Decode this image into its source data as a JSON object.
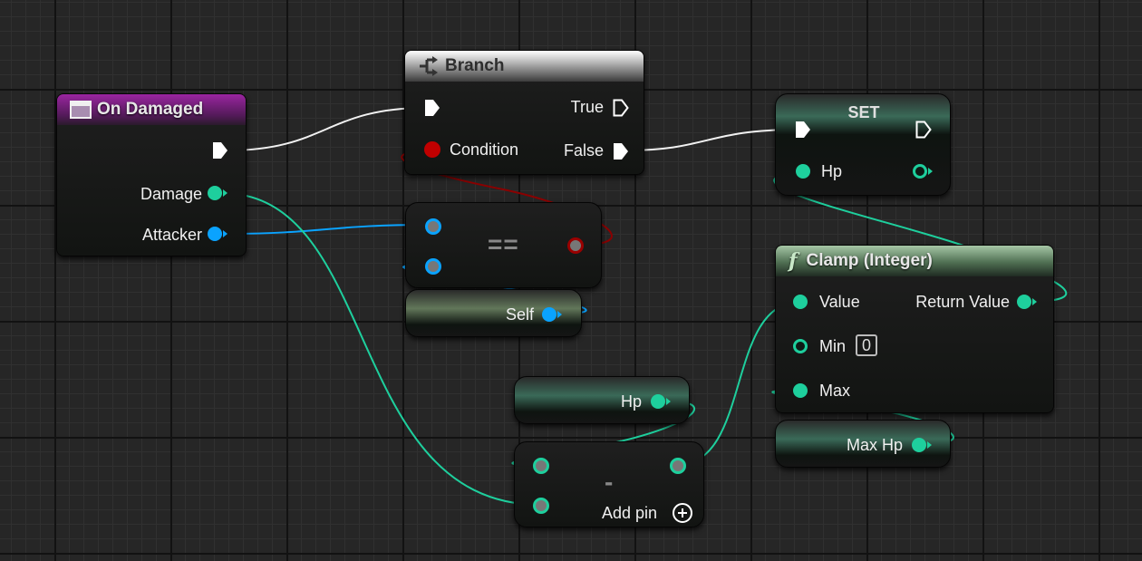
{
  "nodes": {
    "event": {
      "title": "On Damaged",
      "pins": {
        "damage": "Damage",
        "attacker": "Attacker"
      }
    },
    "branch": {
      "title": "Branch",
      "pins": {
        "condition": "Condition",
        "true": "True",
        "false": "False"
      }
    },
    "set": {
      "title": "SET",
      "pins": {
        "hp": "Hp"
      }
    },
    "equals": {
      "op": "=="
    },
    "self": {
      "label": "Self"
    },
    "clamp": {
      "title": "Clamp (Integer)",
      "pins": {
        "value": "Value",
        "min": "Min",
        "max": "Max",
        "return": "Return Value"
      },
      "min_default": "0"
    },
    "hp_getter": {
      "label": "Hp"
    },
    "subtract": {
      "op": "-",
      "add_pin": "Add pin"
    },
    "maxhp_getter": {
      "label": "Max Hp"
    }
  },
  "colors": {
    "event_header": "#9a25a0",
    "function_header": "#4f6f52",
    "integer_pin": "#1ecf9d",
    "object_pin": "#0aa3ff",
    "boolean_pin": "#c00000",
    "exec_pin": "#ffffff",
    "grid_bg": "#262626"
  },
  "icons": {
    "event_icon": "event-node-icon",
    "branch_icon": "branch-icon",
    "function_icon": "function-f-icon",
    "add_pin_icon": "plus-circle-icon"
  }
}
